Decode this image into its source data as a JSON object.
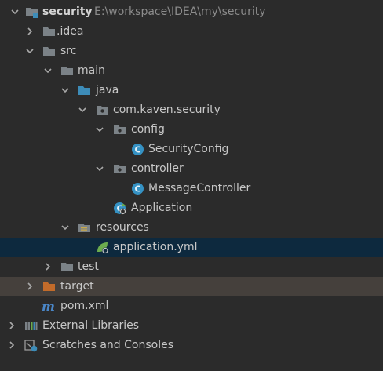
{
  "tree": {
    "root": {
      "label": "security",
      "path": "E:\\workspace\\IDEA\\my\\security"
    },
    "idea": "idea",
    "src": "src",
    "main": "main",
    "java": "java",
    "package": "com.kaven.security",
    "config": "config",
    "security_config": "SecurityConfig",
    "controller": "controller",
    "message_controller": "MessageController",
    "application": "Application",
    "resources": "resources",
    "application_yml": "application.yml",
    "test": "test",
    "target": "target",
    "pom": "pom.xml",
    "external_libraries": "External Libraries",
    "scratches": "Scratches and Consoles"
  },
  "colors": {
    "background": "#2b2b2b",
    "selected_row": "#0d293e",
    "excluded_row": "#45403c",
    "folder_gray": "#7b8287",
    "folder_blue": "#3d8cb8",
    "folder_orange": "#c26b2a",
    "class_icon": "#3592c4",
    "spring_green": "#6cac4e"
  },
  "icons": {
    "expanded": "chevron-down-icon",
    "collapsed": "chevron-right-icon",
    "module": "module-folder-icon",
    "folder": "folder-icon",
    "source_root": "source-folder-icon",
    "package": "package-icon",
    "class": "class-icon",
    "spring_app": "spring-boot-class-icon",
    "resources_root": "resources-folder-icon",
    "yaml": "spring-yaml-icon",
    "excluded": "excluded-folder-icon",
    "maven": "maven-icon",
    "libraries": "libraries-icon",
    "scratches": "scratches-icon"
  }
}
